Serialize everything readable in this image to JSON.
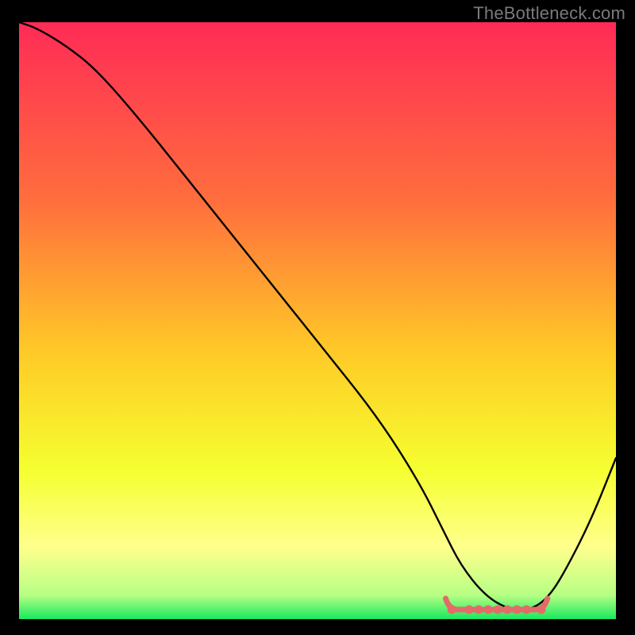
{
  "watermark": "TheBottleneck.com",
  "chart_data": {
    "type": "line",
    "title": "",
    "xlabel": "",
    "ylabel": "",
    "xlim": [
      0,
      100
    ],
    "ylim": [
      0,
      100
    ],
    "background_gradient": {
      "stops": [
        {
          "pos": 0,
          "color": "#ff2b56"
        },
        {
          "pos": 30,
          "color": "#ff6e3d"
        },
        {
          "pos": 55,
          "color": "#ffc927"
        },
        {
          "pos": 75,
          "color": "#f5ff30"
        },
        {
          "pos": 88,
          "color": "#ffff8d"
        },
        {
          "pos": 96,
          "color": "#b6ff84"
        },
        {
          "pos": 100,
          "color": "#18e85f"
        }
      ]
    },
    "series": [
      {
        "name": "bottleneck-curve",
        "color": "#000000",
        "x": [
          0,
          3,
          8,
          13,
          20,
          30,
          40,
          50,
          60,
          67,
          71,
          74,
          78,
          82,
          86,
          89,
          92,
          96,
          100
        ],
        "y": [
          100,
          99,
          96,
          92,
          84,
          71.5,
          59,
          46.5,
          34,
          23,
          15,
          9,
          4,
          1.6,
          1.6,
          4,
          9,
          17,
          27
        ]
      }
    ],
    "bottom_highlight": {
      "name": "optimal-range",
      "color": "#e46a6a",
      "x_range": [
        72,
        88
      ],
      "y": 1.6,
      "dots_x": [
        72.5,
        75.4,
        77.0,
        78.6,
        80.2,
        81.8,
        83.4,
        85.0,
        87.5
      ]
    }
  }
}
